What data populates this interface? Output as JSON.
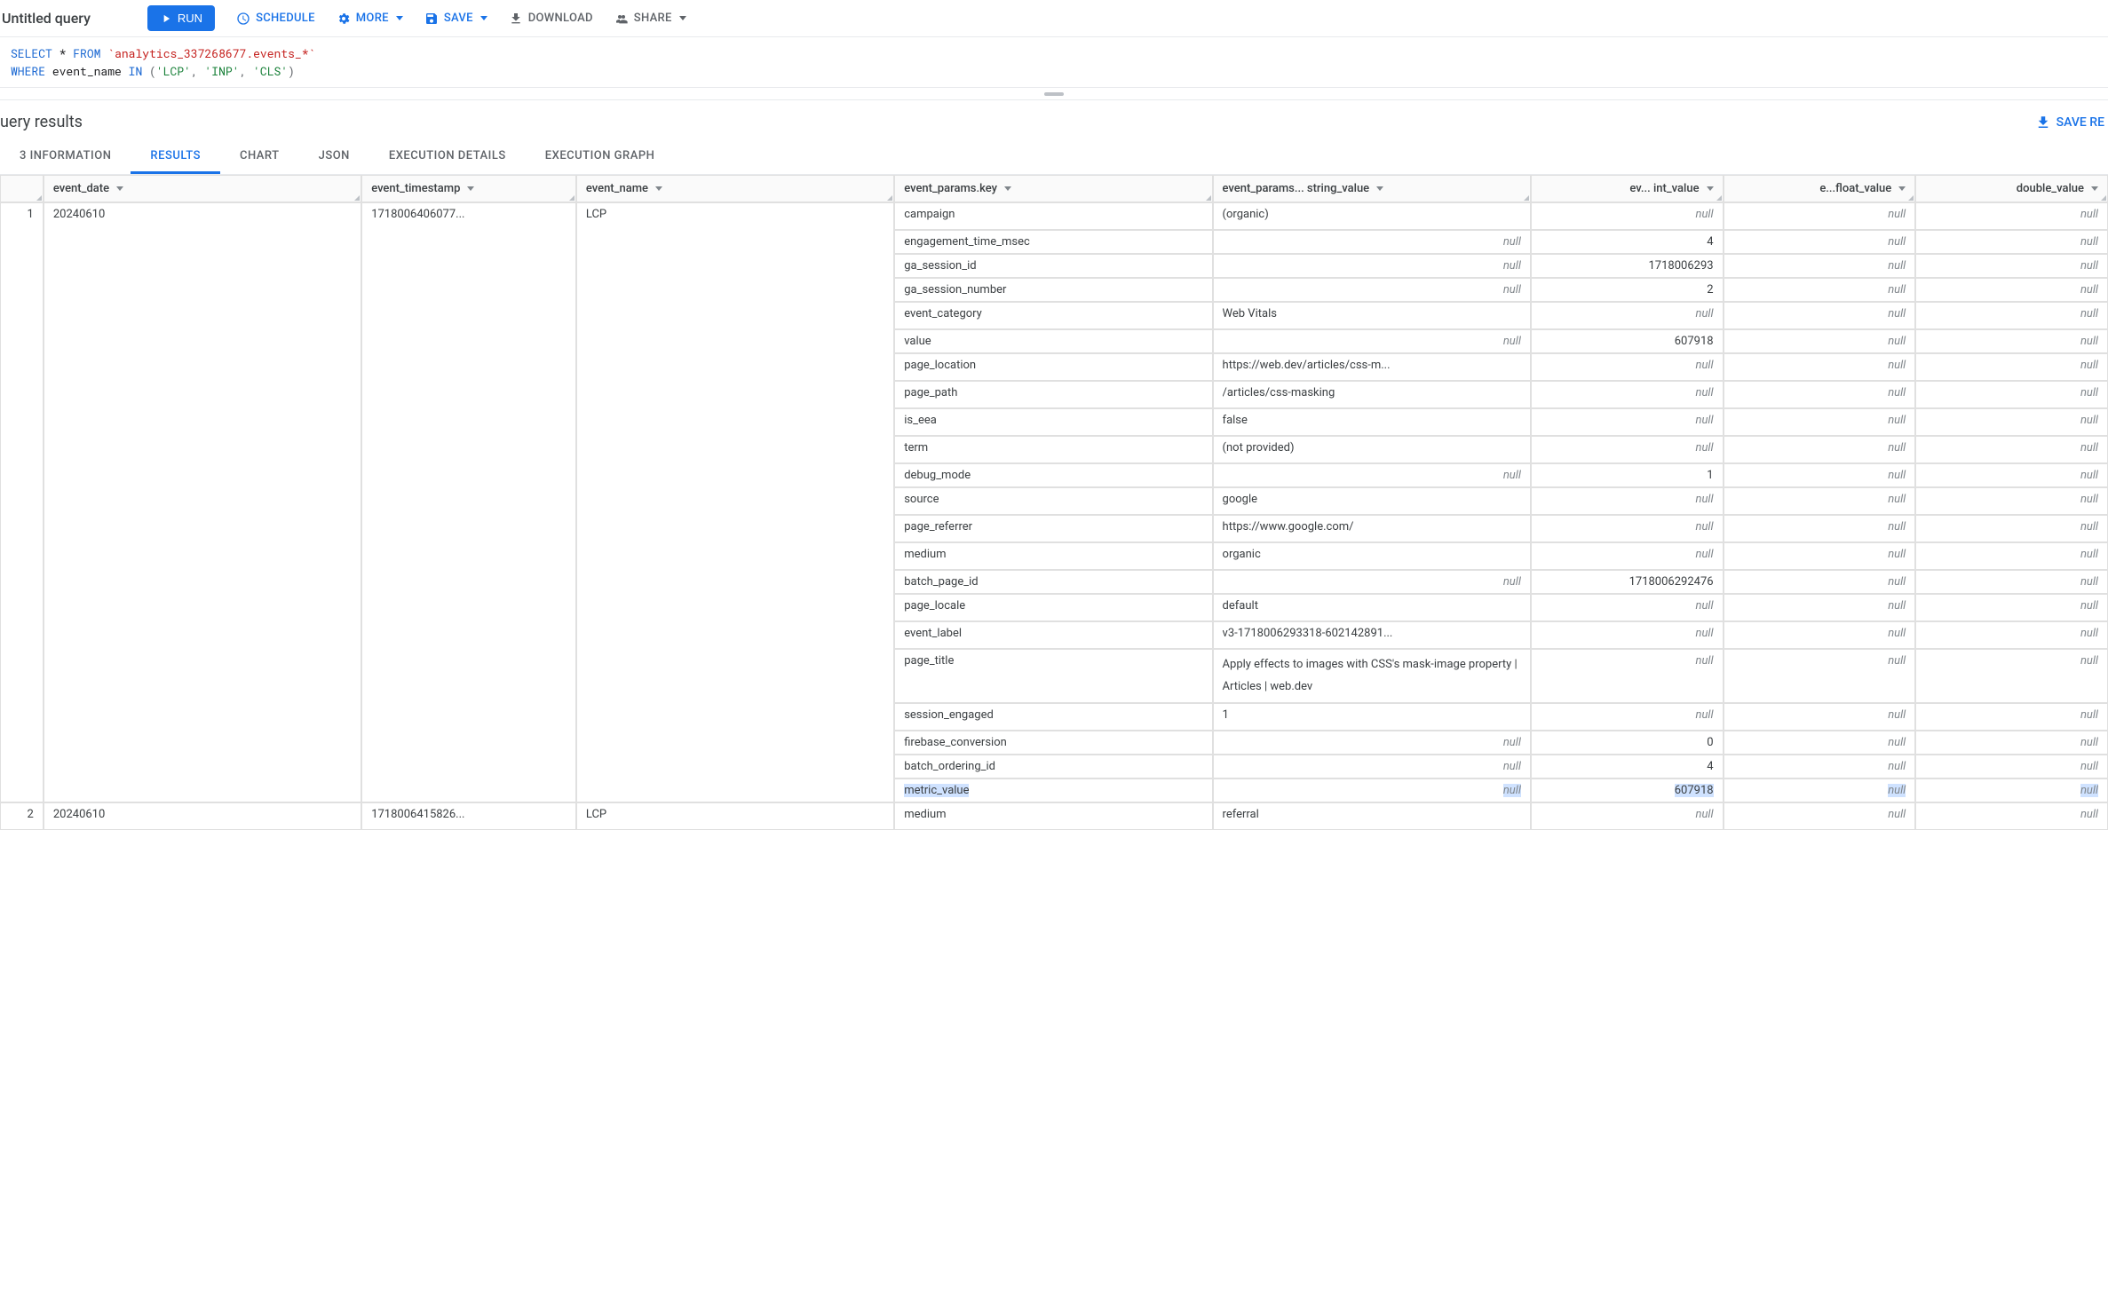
{
  "toolbar": {
    "title": "Untitled query",
    "run": "RUN",
    "schedule": "SCHEDULE",
    "more": "MORE",
    "save": "SAVE",
    "download": "DOWNLOAD",
    "share": "SHARE"
  },
  "sql": {
    "kw_select": "SELECT",
    "star": "*",
    "kw_from": "FROM",
    "table": "`analytics_337268677.events_*`",
    "kw_where": "WHERE",
    "col": " event_name ",
    "kw_in": "IN",
    "paren_open": " (",
    "s1": "'LCP'",
    "s2": "'INP'",
    "s3": "'CLS'",
    "comma": ", ",
    "paren_close": ")"
  },
  "results": {
    "title": "uery results",
    "save_results": "SAVE RE"
  },
  "tabs": [
    {
      "label": "3 INFORMATION",
      "active": false
    },
    {
      "label": "RESULTS",
      "active": true
    },
    {
      "label": "CHART",
      "active": false
    },
    {
      "label": "JSON",
      "active": false
    },
    {
      "label": "EXECUTION DETAILS",
      "active": false
    },
    {
      "label": "EXECUTION GRAPH",
      "active": false
    }
  ],
  "columns": {
    "row": "",
    "event_date": "event_date",
    "event_timestamp": "event_timestamp",
    "event_name": "event_name",
    "key": "event_params.key",
    "string_value": "event_params... string_value",
    "int_value": "ev... int_value",
    "float_value": "e...float_value",
    "double_value": "double_value"
  },
  "groups": [
    {
      "row": "1",
      "event_date": "20240610",
      "event_timestamp": "1718006406077...",
      "event_name": "LCP",
      "params": [
        {
          "key": "campaign",
          "string_value": "(organic)",
          "int_value": null,
          "float_value": null,
          "double_value": null,
          "highlight": false
        },
        {
          "key": "engagement_time_msec",
          "string_value": null,
          "int_value": "4",
          "float_value": null,
          "double_value": null,
          "highlight": false
        },
        {
          "key": "ga_session_id",
          "string_value": null,
          "int_value": "1718006293",
          "float_value": null,
          "double_value": null,
          "highlight": false
        },
        {
          "key": "ga_session_number",
          "string_value": null,
          "int_value": "2",
          "float_value": null,
          "double_value": null,
          "highlight": false
        },
        {
          "key": "event_category",
          "string_value": "Web Vitals",
          "int_value": null,
          "float_value": null,
          "double_value": null,
          "highlight": false
        },
        {
          "key": "value",
          "string_value": null,
          "int_value": "607918",
          "float_value": null,
          "double_value": null,
          "highlight": false
        },
        {
          "key": "page_location",
          "string_value": "https://web.dev/articles/css-m...",
          "int_value": null,
          "float_value": null,
          "double_value": null,
          "highlight": false
        },
        {
          "key": "page_path",
          "string_value": "/articles/css-masking",
          "int_value": null,
          "float_value": null,
          "double_value": null,
          "highlight": false
        },
        {
          "key": "is_eea",
          "string_value": "false",
          "int_value": null,
          "float_value": null,
          "double_value": null,
          "highlight": false
        },
        {
          "key": "term",
          "string_value": "(not provided)",
          "int_value": null,
          "float_value": null,
          "double_value": null,
          "highlight": false
        },
        {
          "key": "debug_mode",
          "string_value": null,
          "int_value": "1",
          "float_value": null,
          "double_value": null,
          "highlight": false
        },
        {
          "key": "source",
          "string_value": "google",
          "int_value": null,
          "float_value": null,
          "double_value": null,
          "highlight": false
        },
        {
          "key": "page_referrer",
          "string_value": "https://www.google.com/",
          "int_value": null,
          "float_value": null,
          "double_value": null,
          "highlight": false
        },
        {
          "key": "medium",
          "string_value": "organic",
          "int_value": null,
          "float_value": null,
          "double_value": null,
          "highlight": false
        },
        {
          "key": "batch_page_id",
          "string_value": null,
          "int_value": "1718006292476",
          "float_value": null,
          "double_value": null,
          "highlight": false
        },
        {
          "key": "page_locale",
          "string_value": "default",
          "int_value": null,
          "float_value": null,
          "double_value": null,
          "highlight": false
        },
        {
          "key": "event_label",
          "string_value": "v3-1718006293318-602142891...",
          "int_value": null,
          "float_value": null,
          "double_value": null,
          "highlight": false
        },
        {
          "key": "page_title",
          "string_value": "Apply effects to images with CSS's mask-image property  |  Articles  |  web.dev",
          "int_value": null,
          "float_value": null,
          "double_value": null,
          "highlight": false,
          "wrap": true
        },
        {
          "key": "session_engaged",
          "string_value": "1",
          "int_value": null,
          "float_value": null,
          "double_value": null,
          "highlight": false
        },
        {
          "key": "firebase_conversion",
          "string_value": null,
          "int_value": "0",
          "float_value": null,
          "double_value": null,
          "highlight": false
        },
        {
          "key": "batch_ordering_id",
          "string_value": null,
          "int_value": "4",
          "float_value": null,
          "double_value": null,
          "highlight": false
        },
        {
          "key": "metric_value",
          "string_value": null,
          "int_value": "607918",
          "float_value": null,
          "double_value": null,
          "highlight": true
        }
      ]
    },
    {
      "row": "2",
      "event_date": "20240610",
      "event_timestamp": "1718006415826...",
      "event_name": "LCP",
      "params": [
        {
          "key": "medium",
          "string_value": "referral",
          "int_value": null,
          "float_value": null,
          "double_value": null,
          "highlight": false
        }
      ]
    }
  ],
  "null_label": "null"
}
